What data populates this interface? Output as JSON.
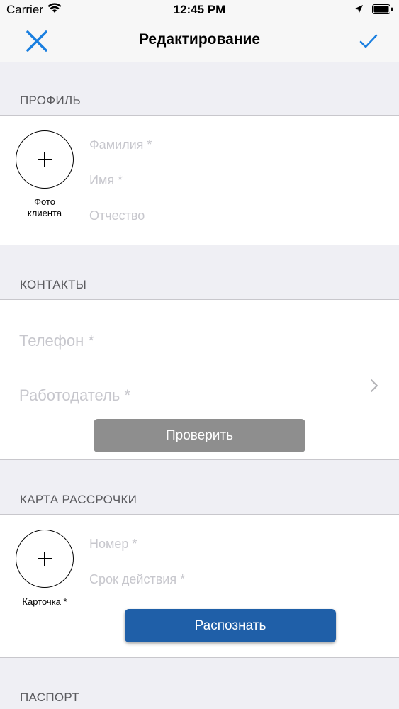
{
  "status_bar": {
    "carrier": "Carrier",
    "time": "12:45 PM",
    "icons": [
      "wifi-icon",
      "location-arrow-icon",
      "battery-icon"
    ]
  },
  "nav": {
    "title": "Редактирование",
    "close_icon": "close-icon",
    "done_icon": "checkmark-icon",
    "accent_color": "#1a7fe0"
  },
  "profile": {
    "header": "ПРОФИЛЬ",
    "photo_caption_line1": "Фото",
    "photo_caption_line2": "клиента",
    "last_name_placeholder": "Фамилия *",
    "first_name_placeholder": "Имя *",
    "middle_name_placeholder": "Отчество"
  },
  "contacts": {
    "header": "КОНТАКТЫ",
    "phone_placeholder": "Телефон *",
    "employer_placeholder": "Работодатель *",
    "check_button": "Проверить"
  },
  "installment_card": {
    "header": "КАРТА РАССРОЧКИ",
    "photo_caption": "Карточка *",
    "number_placeholder": "Номер *",
    "expiry_placeholder": "Срок действия *",
    "recognize_button": "Распознать",
    "button_color": "#1f5fa8"
  },
  "passport": {
    "header": "ПАСПОРТ"
  }
}
